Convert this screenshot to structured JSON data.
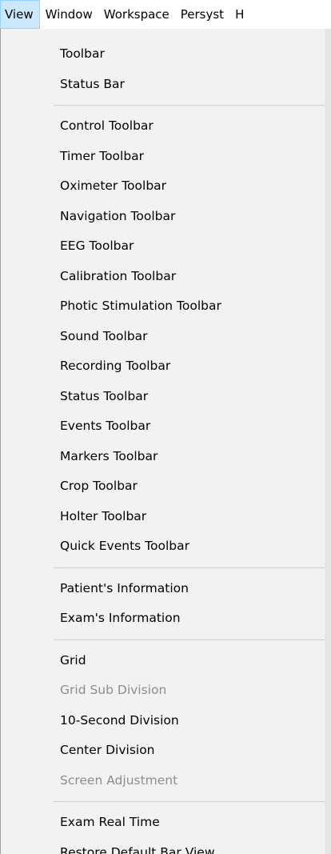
{
  "menubar": {
    "items": [
      "View",
      "Window",
      "Workspace",
      "Persyst",
      "H"
    ]
  },
  "view_menu": {
    "groups": [
      {
        "items": [
          {
            "label": "Toolbar",
            "enabled": true
          },
          {
            "label": "Status Bar",
            "enabled": true
          }
        ]
      },
      {
        "items": [
          {
            "label": "Control Toolbar",
            "enabled": true
          },
          {
            "label": "Timer Toolbar",
            "enabled": true
          },
          {
            "label": "Oximeter Toolbar",
            "enabled": true
          },
          {
            "label": "Navigation Toolbar",
            "enabled": true
          },
          {
            "label": "EEG Toolbar",
            "enabled": true
          },
          {
            "label": "Calibration Toolbar",
            "enabled": true
          },
          {
            "label": "Photic Stimulation Toolbar",
            "enabled": true
          },
          {
            "label": "Sound Toolbar",
            "enabled": true
          },
          {
            "label": "Recording Toolbar",
            "enabled": true
          },
          {
            "label": "Status Toolbar",
            "enabled": true
          },
          {
            "label": "Events Toolbar",
            "enabled": true
          },
          {
            "label": "Markers Toolbar",
            "enabled": true
          },
          {
            "label": "Crop Toolbar",
            "enabled": true
          },
          {
            "label": "Holter Toolbar",
            "enabled": true
          },
          {
            "label": "Quick Events Toolbar",
            "enabled": true
          }
        ]
      },
      {
        "items": [
          {
            "label": "Patient's Information",
            "enabled": true
          },
          {
            "label": "Exam's Information",
            "enabled": true
          }
        ]
      },
      {
        "items": [
          {
            "label": "Grid",
            "enabled": true
          },
          {
            "label": "Grid Sub Division",
            "enabled": false
          },
          {
            "label": "10-Second Division",
            "enabled": true
          },
          {
            "label": "Center Division",
            "enabled": true
          },
          {
            "label": "Screen Adjustment",
            "enabled": false
          }
        ]
      },
      {
        "items": [
          {
            "label": "Exam Real Time",
            "enabled": true
          },
          {
            "label": "Restore Default Bar View",
            "enabled": true
          }
        ]
      }
    ]
  }
}
